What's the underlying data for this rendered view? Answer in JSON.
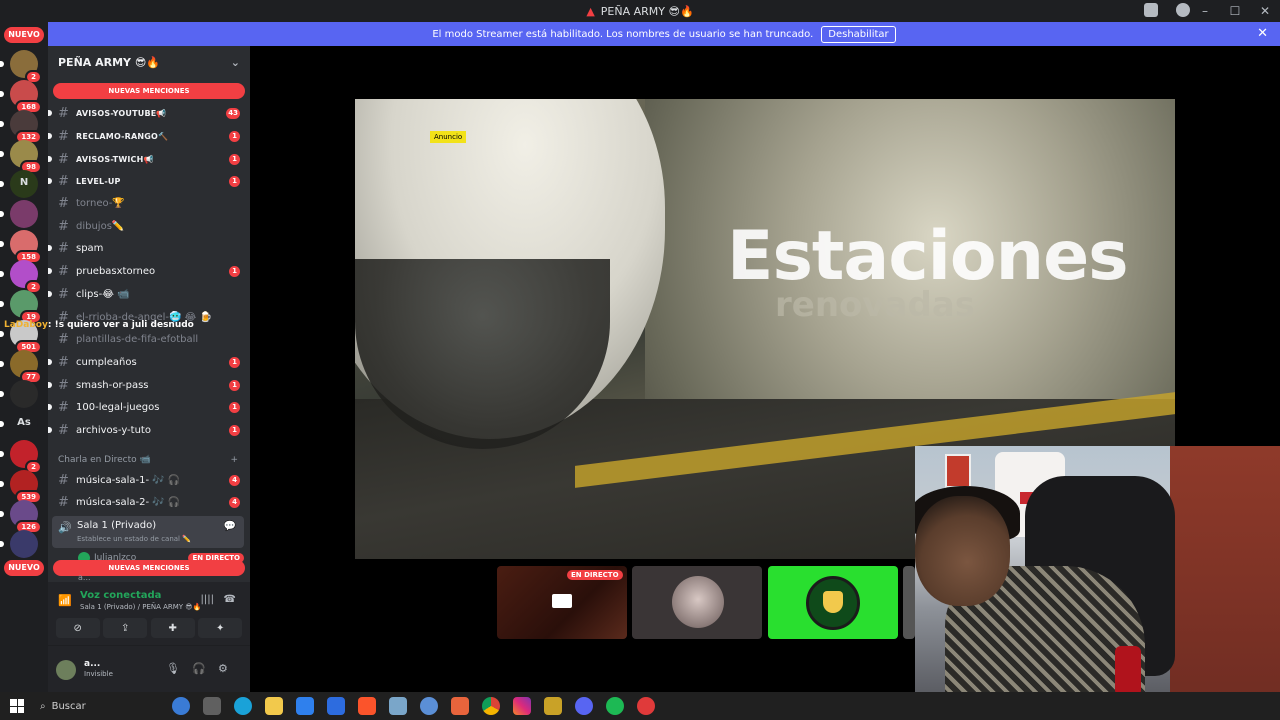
{
  "window": {
    "title": "PEÑA ARMY 😎🔥"
  },
  "streamer_banner": {
    "text": "El modo Streamer está habilitado. Los nombres de usuario se han truncado.",
    "button": "Deshabilitar"
  },
  "guilds": {
    "nuevo_top": "NUEVO",
    "nuevo_bottom": "NUEVO",
    "items": [
      {
        "badge": "2",
        "color": "#8a6d3b"
      },
      {
        "badge": "168",
        "color": "#c94b4b"
      },
      {
        "badge": "132",
        "color": "#4a3b3b"
      },
      {
        "badge": "98",
        "color": "#9a8a4a"
      },
      {
        "badge": "",
        "label": "N",
        "color": "#2a3a1a"
      },
      {
        "badge": "",
        "color": "#7a3b6a"
      },
      {
        "badge": "158",
        "color": "#d96c6c"
      },
      {
        "badge": "2",
        "color": "#b24ec9"
      },
      {
        "badge": "19",
        "color": "#5a9a6a"
      },
      {
        "badge": "501",
        "color": "#c9c9c9"
      },
      {
        "badge": "77",
        "color": "#8a6a2a"
      },
      {
        "badge": "",
        "color": "#2a2a2a"
      },
      {
        "badge": "",
        "label": "As",
        "color": "#1e1f22"
      },
      {
        "badge": "2",
        "color": "#c2222b"
      },
      {
        "badge": "539",
        "color": "#b22222"
      },
      {
        "badge": "126",
        "color": "#6a4a8a"
      },
      {
        "badge": "",
        "color": "#3a3a6a"
      }
    ]
  },
  "server": {
    "name": "PEÑA ARMY 😎🔥",
    "mentions_top": "NUEVAS MENCIONES",
    "mentions_bottom": "NUEVAS MENCIONES",
    "channels": [
      {
        "name": "AVISOS-YOUTUBE📢",
        "count": "43",
        "unread": true,
        "upper": true
      },
      {
        "name": "RECLAMO-RANGO🔨",
        "count": "1",
        "unread": true,
        "upper": true
      },
      {
        "name": "AVISOS-TWICH📢",
        "count": "1",
        "unread": true,
        "upper": true
      },
      {
        "name": "LEVEL-UP",
        "count": "1",
        "unread": true,
        "upper": true
      },
      {
        "name": "torneo-🏆",
        "count": "",
        "unread": false,
        "upper": false
      },
      {
        "name": "dibujos✏️",
        "count": "",
        "unread": false,
        "upper": false
      },
      {
        "name": "spam",
        "count": "",
        "unread": true,
        "upper": false
      },
      {
        "name": "pruebasxtorneo",
        "count": "1",
        "unread": true,
        "upper": false
      },
      {
        "name": "clips-😂 📹",
        "count": "",
        "unread": true,
        "upper": false
      },
      {
        "name": "el-rrioba-de-angel-🥶 😂 🍺",
        "count": "",
        "unread": false,
        "upper": false
      },
      {
        "name": "plantillas-de-fifa-efotball",
        "count": "",
        "unread": false,
        "upper": false
      },
      {
        "name": "cumpleaños",
        "count": "1",
        "unread": true,
        "upper": false
      },
      {
        "name": "smash-or-pass",
        "count": "1",
        "unread": true,
        "upper": false
      },
      {
        "name": "100-legal-juegos",
        "count": "1",
        "unread": true,
        "upper": false
      },
      {
        "name": "archivos-y-tuto",
        "count": "1",
        "unread": true,
        "upper": false
      }
    ],
    "category": "Charla en Directo 📹",
    "voice_channels": [
      {
        "name": "música-sala-1- 🎶 🎧",
        "count": "4"
      },
      {
        "name": "música-sala-2- 🎶 🎧",
        "count": "4"
      }
    ],
    "active_voice": {
      "name": "Sala 1 (Privado)",
      "status": "Establece un estado de canal ✏️"
    },
    "member_live": "Julianlzco",
    "member_other": "a...",
    "live_label": "EN DIRECTO"
  },
  "chat_overlay": {
    "user": "LaDaboy",
    "message": ": !s quiero ver a juli desnudo"
  },
  "voice_panel": {
    "status": "Voz conectada",
    "location": "Sala 1 (Privado) / PEÑA ARMY 😎🔥"
  },
  "user_panel": {
    "name": "a...",
    "status": "Invisible"
  },
  "stream": {
    "ad_tag": "Anuncio",
    "title_text": "Estaciones",
    "subtitle_text": "renovadas",
    "tile_live_label": "EN DIRECTO"
  },
  "taskbar": {
    "search_label": "Buscar"
  }
}
